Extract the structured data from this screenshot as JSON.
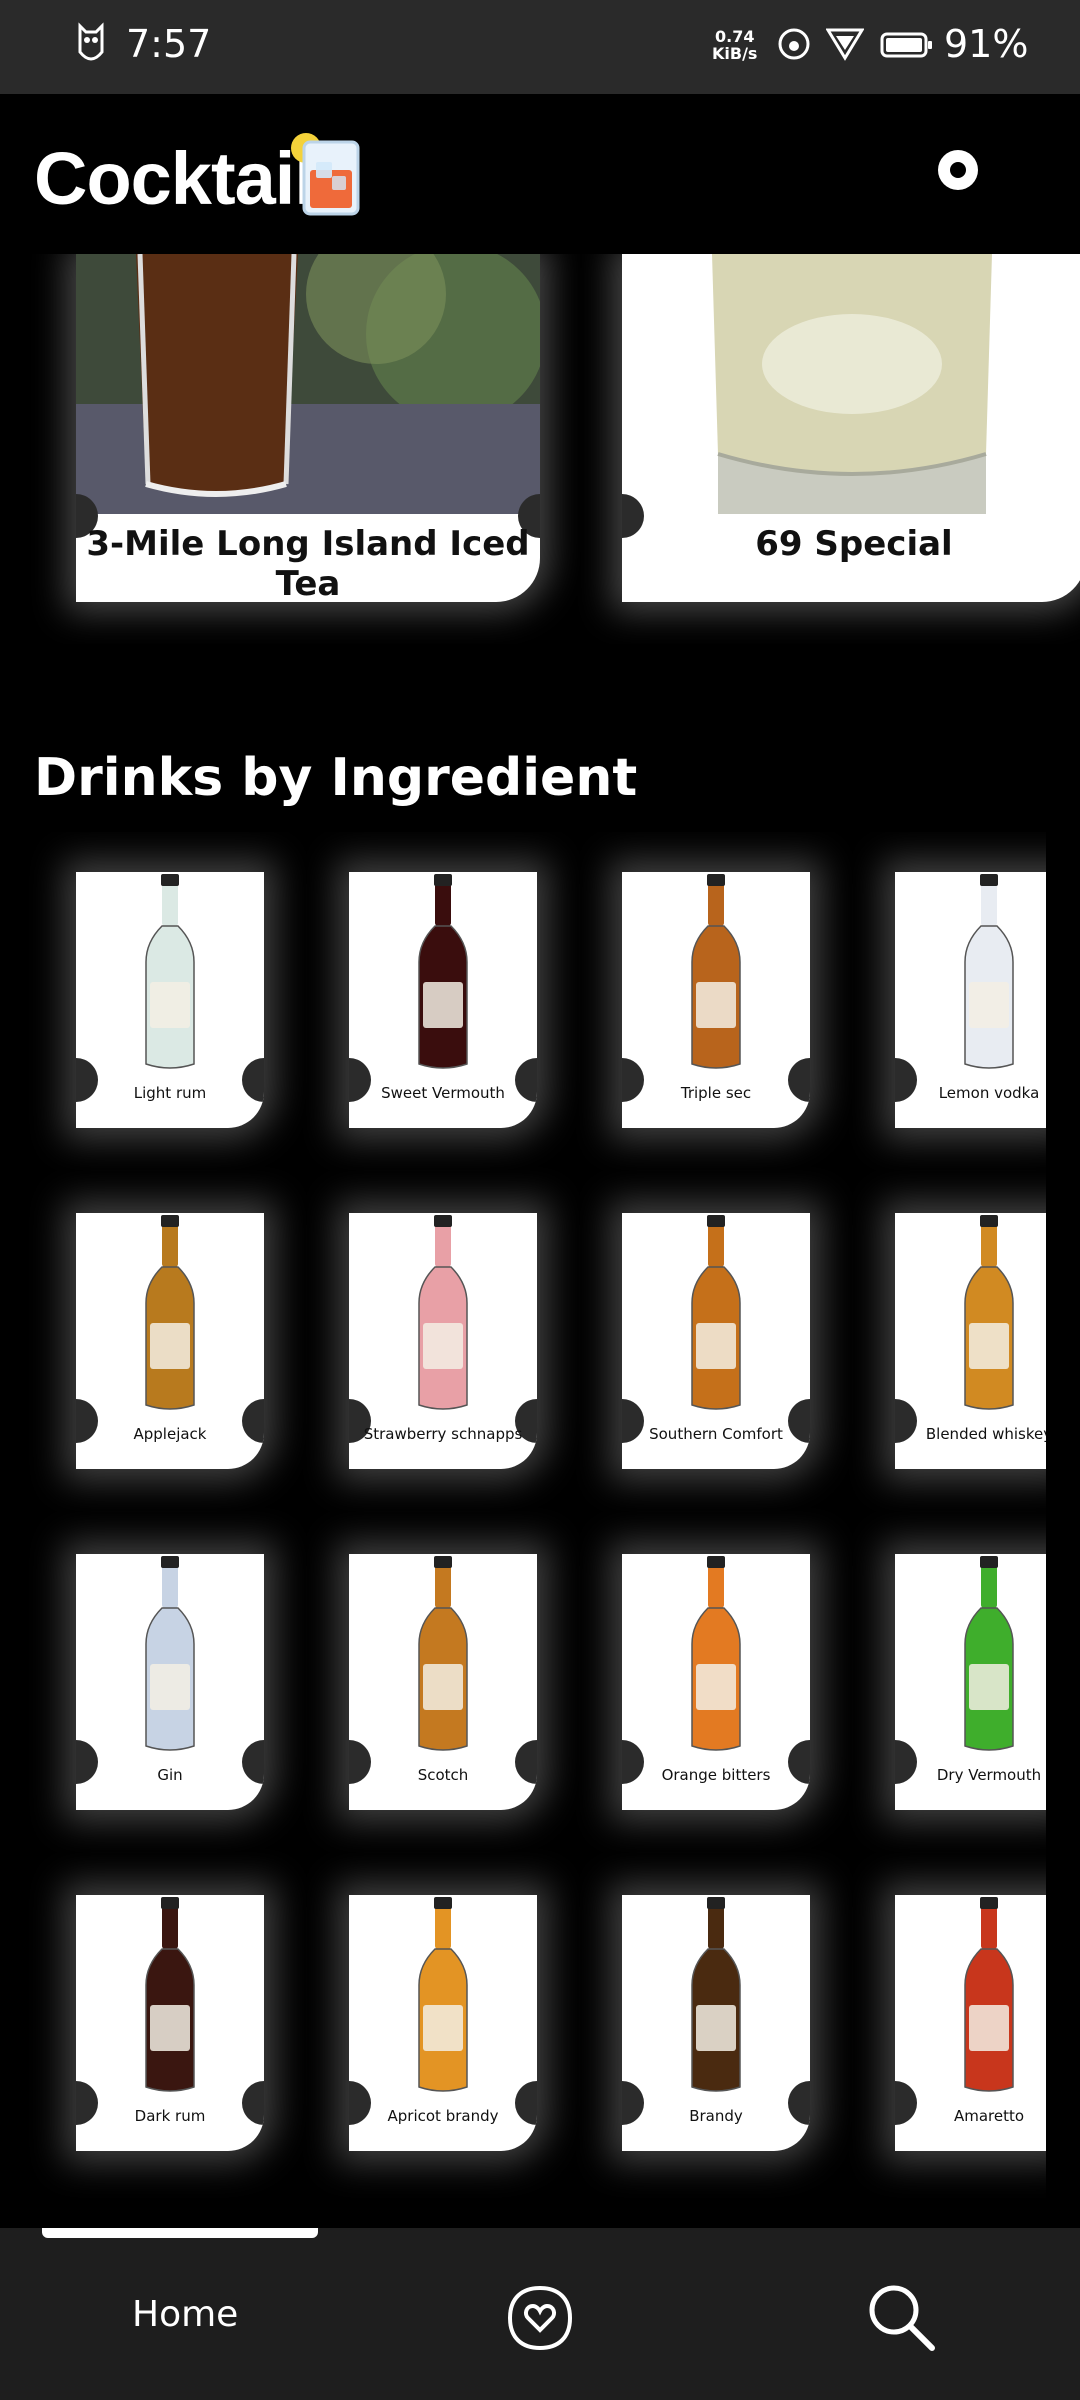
{
  "status_bar": {
    "time": "7:57",
    "net_speed_value": "0.74",
    "net_speed_unit": "KiB/s",
    "battery_percent": "91%"
  },
  "header": {
    "title": "Cocktail",
    "logo_icon": "cocktail-glass-icon",
    "theme_toggle_icon": "theme-toggle-icon"
  },
  "featured": [
    {
      "title": "3-Mile Long Island Iced Tea",
      "liquid_color": "#5a2e14"
    },
    {
      "title": "69 Special",
      "liquid_color": "#d8d6b4"
    }
  ],
  "section": {
    "title": "Drinks by Ingredient"
  },
  "ingredients": [
    [
      {
        "name": "Light rum",
        "color": "#dbe9e4"
      },
      {
        "name": "Sweet Vermouth",
        "color": "#3a0d0d"
      },
      {
        "name": "Triple sec",
        "color": "#b8641c"
      },
      {
        "name": "Lemon vodka",
        "color": "#e8ecf2"
      }
    ],
    [
      {
        "name": "Applejack",
        "color": "#b87a1e"
      },
      {
        "name": "Strawberry schnapps",
        "color": "#e8a0a6"
      },
      {
        "name": "Southern Comfort",
        "color": "#c5701a"
      },
      {
        "name": "Blended whiskey",
        "color": "#d18a22"
      }
    ],
    [
      {
        "name": "Gin",
        "color": "#c7d3e4"
      },
      {
        "name": "Scotch",
        "color": "#c47920"
      },
      {
        "name": "Orange bitters",
        "color": "#e37a22"
      },
      {
        "name": "Dry Vermouth",
        "color": "#3fae2c"
      }
    ],
    [
      {
        "name": "Dark rum",
        "color": "#3a1610"
      },
      {
        "name": "Apricot brandy",
        "color": "#e39424"
      },
      {
        "name": "Brandy",
        "color": "#4a2a10"
      },
      {
        "name": "Amaretto",
        "color": "#c8361c"
      }
    ]
  ],
  "bottom_nav": {
    "home_label": "Home",
    "favorites_icon": "heart-badge-icon",
    "search_icon": "search-icon"
  }
}
